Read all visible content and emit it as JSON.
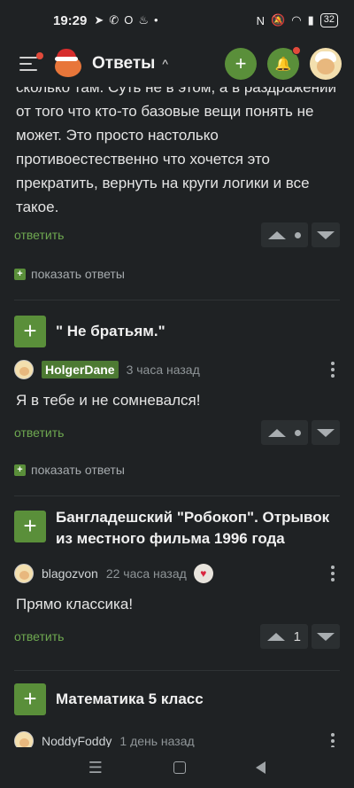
{
  "status_bar": {
    "time": "19:29",
    "left_icons": [
      "telegram-icon",
      "whatsapp-icon",
      "opera-icon",
      "fire-icon",
      "dot-icon"
    ],
    "right_icons": [
      "nfc-icon",
      "mute-icon",
      "wifi-icon",
      "signal-icon"
    ],
    "battery": "32"
  },
  "appbar": {
    "title": "Ответы",
    "caret": "^",
    "add_icon": "+",
    "bell_icon": "🔔"
  },
  "comments": [
    {
      "text": "сколько там. Суть не в этом, а в раздражении от того что кто-то базовые вещи понять не может. Это просто настолько противоестественно что хочется это прекратить, вернуть на круги логики и все такое.",
      "reply": "ответить",
      "show_replies": "показать ответы"
    }
  ],
  "posts": [
    {
      "title": "\" Не братьям.\"",
      "author": "HolgerDane",
      "time": "3 часа назад",
      "text": "Я в тебе и не сомневался!",
      "reply": "ответить",
      "show_replies": "показать ответы"
    },
    {
      "title": "Бангладешский \"Робокоп\". Отрывок из местного фильма 1996 года",
      "author": "blagozvon",
      "time": "22 часа назад",
      "text": "Прямо классика!",
      "reply": "ответить",
      "votes": "1"
    },
    {
      "title": "Математика 5 класс",
      "author": "NoddyFoddy",
      "time": "1 день назад"
    }
  ],
  "colors": {
    "background": "#1f2224",
    "accent_green": "#5a8f3a",
    "link_green": "#6ea850",
    "notification_red": "#e24a3b"
  }
}
